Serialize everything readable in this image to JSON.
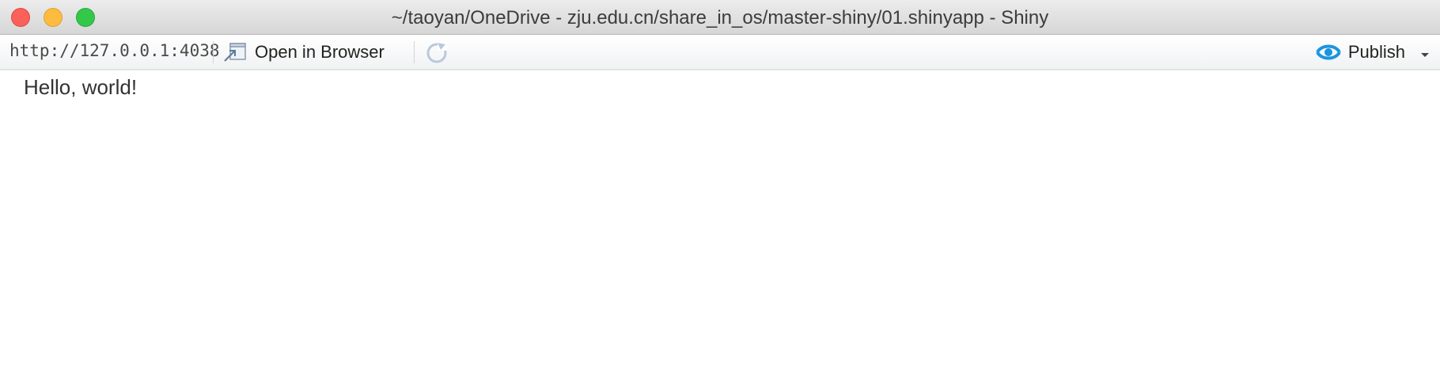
{
  "window": {
    "title": "~/taoyan/OneDrive - zju.edu.cn/share_in_os/master-shiny/01.shinyapp - Shiny"
  },
  "toolbar": {
    "url": "http://127.0.0.1:4038",
    "open_in_browser_label": "Open in Browser",
    "publish_label": "Publish",
    "icons": {
      "open_in_browser": "open-in-browser-icon",
      "refresh": "refresh-icon",
      "publish": "publish-icon",
      "dropdown": "chevron-down-icon"
    }
  },
  "content": {
    "text": "Hello, world!"
  },
  "colors": {
    "close": "#fc605b",
    "minimize": "#fdbc40",
    "zoom": "#34c84a",
    "publish_accent": "#1a95e0"
  }
}
